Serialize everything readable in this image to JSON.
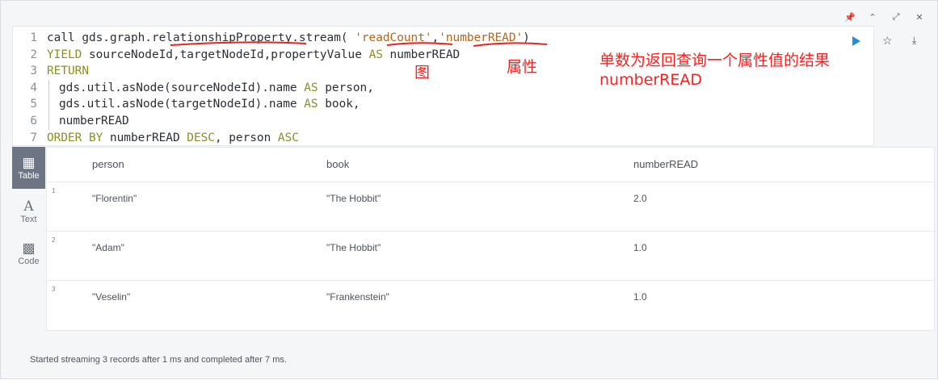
{
  "editor": {
    "lines": [
      {
        "num": "1",
        "parts": [
          {
            "t": "call gds.graph.relationshipProperty.stream( ",
            "c": "txt"
          },
          {
            "t": "'readCount'",
            "c": "str"
          },
          {
            "t": ",",
            "c": "txt"
          },
          {
            "t": "'numberREAD'",
            "c": "str"
          },
          {
            "t": ")",
            "c": "txt"
          }
        ]
      },
      {
        "num": "2",
        "parts": [
          {
            "t": "YIELD",
            "c": "kw"
          },
          {
            "t": " sourceNodeId,targetNodeId,propertyValue ",
            "c": "txt"
          },
          {
            "t": "AS",
            "c": "kw"
          },
          {
            "t": " numberREAD",
            "c": "txt"
          }
        ]
      },
      {
        "num": "3",
        "parts": [
          {
            "t": "RETURN",
            "c": "kw"
          }
        ]
      },
      {
        "num": "4",
        "indent": true,
        "parts": [
          {
            "t": "gds.util.asNode(sourceNodeId).name ",
            "c": "txt"
          },
          {
            "t": "AS",
            "c": "kw"
          },
          {
            "t": " person,",
            "c": "txt"
          }
        ]
      },
      {
        "num": "5",
        "indent": true,
        "parts": [
          {
            "t": "gds.util.asNode(targetNodeId).name ",
            "c": "txt"
          },
          {
            "t": "AS",
            "c": "kw"
          },
          {
            "t": " book,",
            "c": "txt"
          }
        ]
      },
      {
        "num": "6",
        "indent": true,
        "parts": [
          {
            "t": "numberREAD",
            "c": "txt"
          }
        ]
      },
      {
        "num": "7",
        "parts": [
          {
            "t": "ORDER BY",
            "c": "kw"
          },
          {
            "t": " numberREAD ",
            "c": "txt"
          },
          {
            "t": "DESC",
            "c": "kw"
          },
          {
            "t": ", person ",
            "c": "txt"
          },
          {
            "t": "ASC",
            "c": "kw"
          }
        ]
      }
    ]
  },
  "annotations": {
    "graph_label": "图",
    "property_label": "属性",
    "note_line1": "单数为返回查询一个属性值的结果",
    "note_line2": "numberREAD",
    "color": "#ff1e1e"
  },
  "top_toolbar": {
    "pin_icon": "pin-icon",
    "collapse_icon": "chevron-up-icon",
    "expand_icon": "expand-icon",
    "close_icon": "close-icon"
  },
  "actions": {
    "run_icon": "play-icon",
    "favorite_icon": "star-icon",
    "download_icon": "download-icon",
    "run_color": "#1c8ee3"
  },
  "sidebar": {
    "items": [
      {
        "label": "Table",
        "icon": "table-icon",
        "active": true
      },
      {
        "label": "Text",
        "icon": "text-icon",
        "active": false
      },
      {
        "label": "Code",
        "icon": "code-icon",
        "active": false
      }
    ]
  },
  "table": {
    "headers": [
      "person",
      "book",
      "numberREAD"
    ],
    "rows": [
      {
        "num": "1",
        "cells": [
          "\"Florentin\"",
          "\"The Hobbit\"",
          "2.0"
        ]
      },
      {
        "num": "2",
        "cells": [
          "\"Adam\"",
          "\"The Hobbit\"",
          "1.0"
        ]
      },
      {
        "num": "3",
        "cells": [
          "\"Veselin\"",
          "\"Frankenstein\"",
          "1.0"
        ]
      }
    ]
  },
  "status": "Started streaming 3 records after 1 ms and completed after 7 ms."
}
